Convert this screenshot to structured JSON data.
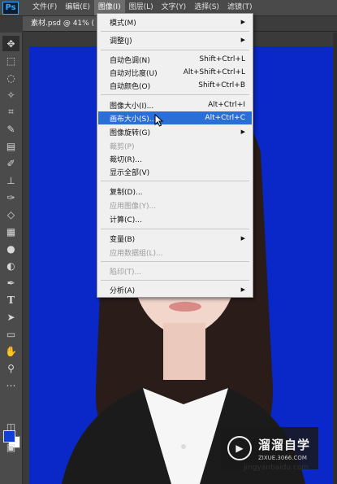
{
  "app": {
    "logo": "Ps",
    "menus": [
      "文件(F)",
      "编辑(E)",
      "图像(I)",
      "图层(L)",
      "文字(Y)",
      "选择(S)",
      "滤镜(T)"
    ],
    "active_menu_index": 2
  },
  "document": {
    "tab_label": "素材.psd @ 41% ("
  },
  "image_menu": {
    "items": [
      {
        "label": "模式(M)",
        "shortcut": "",
        "submenu": true,
        "disabled": false
      },
      {
        "label": "调整(J)",
        "shortcut": "",
        "submenu": true,
        "disabled": false
      },
      {
        "label": "自动色调(N)",
        "shortcut": "Shift+Ctrl+L",
        "submenu": false,
        "disabled": false
      },
      {
        "label": "自动对比度(U)",
        "shortcut": "Alt+Shift+Ctrl+L",
        "submenu": false,
        "disabled": false
      },
      {
        "label": "自动颜色(O)",
        "shortcut": "Shift+Ctrl+B",
        "submenu": false,
        "disabled": false
      },
      {
        "label": "图像大小(I)...",
        "shortcut": "Alt+Ctrl+I",
        "submenu": false,
        "disabled": false
      },
      {
        "label": "画布大小(S)...",
        "shortcut": "Alt+Ctrl+C",
        "submenu": false,
        "disabled": false,
        "highlighted": true
      },
      {
        "label": "图像旋转(G)",
        "shortcut": "",
        "submenu": true,
        "disabled": false
      },
      {
        "label": "裁剪(P)",
        "shortcut": "",
        "submenu": false,
        "disabled": true
      },
      {
        "label": "裁切(R)...",
        "shortcut": "",
        "submenu": false,
        "disabled": false
      },
      {
        "label": "显示全部(V)",
        "shortcut": "",
        "submenu": false,
        "disabled": false
      },
      {
        "label": "复制(D)...",
        "shortcut": "",
        "submenu": false,
        "disabled": false
      },
      {
        "label": "应用图像(Y)...",
        "shortcut": "",
        "submenu": false,
        "disabled": true
      },
      {
        "label": "计算(C)...",
        "shortcut": "",
        "submenu": false,
        "disabled": false
      },
      {
        "label": "变量(B)",
        "shortcut": "",
        "submenu": true,
        "disabled": false
      },
      {
        "label": "应用数据组(L)...",
        "shortcut": "",
        "submenu": false,
        "disabled": true
      },
      {
        "label": "陷印(T)...",
        "shortcut": "",
        "submenu": false,
        "disabled": true
      },
      {
        "label": "分析(A)",
        "shortcut": "",
        "submenu": true,
        "disabled": false
      }
    ]
  },
  "tools": [
    "move-tool-icon",
    "marquee-tool-icon",
    "lasso-tool-icon",
    "magic-wand-icon",
    "crop-tool-icon",
    "eyedropper-icon",
    "healing-brush-icon",
    "brush-tool-icon",
    "clone-stamp-icon",
    "history-brush-icon",
    "eraser-icon",
    "gradient-icon",
    "blur-icon",
    "dodge-icon",
    "pen-tool-icon",
    "type-tool-icon",
    "path-select-icon",
    "shape-tool-icon",
    "hand-tool-icon",
    "zoom-tool-icon",
    "more-tools-icon"
  ],
  "colors": {
    "foreground": "#0f3fd8",
    "background": "#ffffff",
    "canvas_background": "#0a27c8",
    "menu_highlight": "#2b6fd6"
  },
  "watermark": {
    "name": "溜溜自学",
    "url": "ZIXUE.3066.COM",
    "strip": "jingyanbaidu.com"
  }
}
